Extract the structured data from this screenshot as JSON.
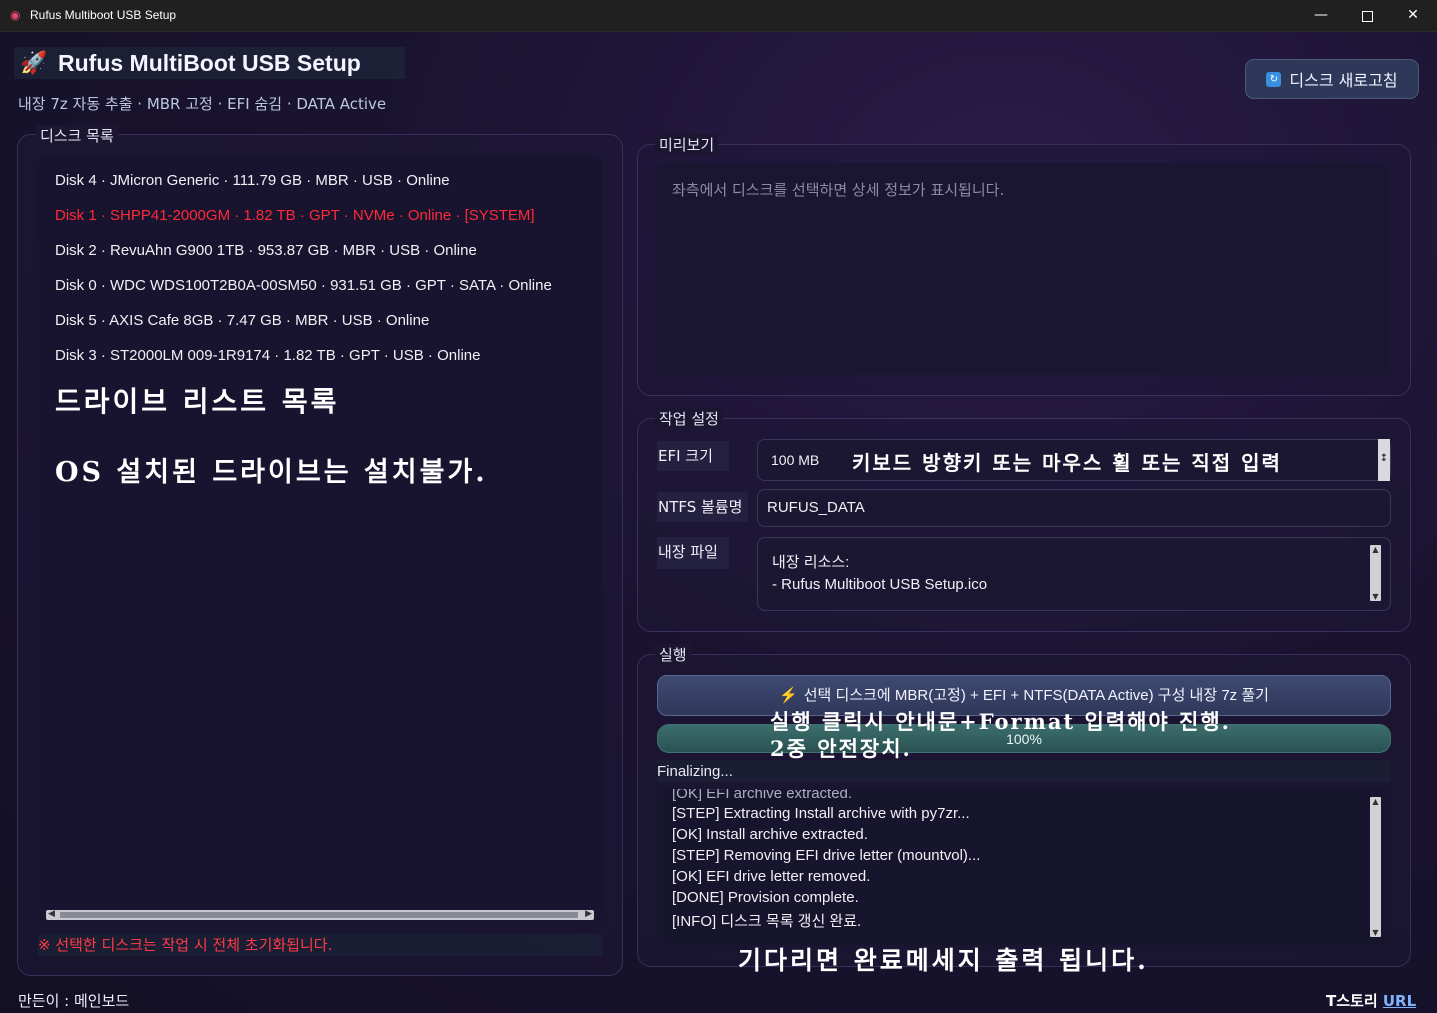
{
  "window": {
    "title": "Rufus Multiboot USB Setup"
  },
  "header": {
    "title": "Rufus MultiBoot USB Setup",
    "subtitle": "내장 7z 자동 추출 · MBR 고정 · EFI 숨김 · DATA Active",
    "refresh_label": "디스크 새로고침"
  },
  "disk_panel": {
    "label": "디스크 목록",
    "rows": [
      "Disk 4 · JMicron Generic · 111.79 GB · MBR · USB · Online",
      "Disk 1 · SHPP41-2000GM · 1.82 TB · GPT · NVMe · Online · [SYSTEM]",
      "Disk 2 · RevuAhn G900 1TB · 953.87 GB · MBR · USB · Online",
      "Disk 0 · WDC WDS100T2B0A-00SM50 · 931.51 GB · GPT · SATA · Online",
      "Disk 5 · AXIS Cafe 8GB · 7.47 GB · MBR · USB · Online",
      "Disk 3 · ST2000LM 009-1R9174 · 1.82 TB · GPT · USB · Online"
    ],
    "system_color": "#ff2a36",
    "annotation_1": "드라이브 리스트 목록",
    "annotation_2": "OS 설치된 드라이브는 설치불가.",
    "warning": "※ 선택한 디스크는 작업 시 전체 초기화됩니다."
  },
  "preview": {
    "label": "미리보기",
    "placeholder": "좌측에서 디스크를 선택하면 상세 정보가 표시됩니다."
  },
  "settings": {
    "label": "작업 설정",
    "efi_label": "EFI 크기",
    "efi_value": "100 MB",
    "efi_annotation": "키보드 방향키 또는 마우스 휠 또는 직접 입력",
    "ntfs_label": "NTFS 볼륨명",
    "ntfs_value": "RUFUS_DATA",
    "files_label": "내장 파일",
    "files_line1": "내장 리소스:",
    "files_line2": "- Rufus Multiboot USB Setup.ico"
  },
  "execute": {
    "label": "실행",
    "button_label": "선택 디스크에 MBR(고정) + EFI + NTFS(DATA Active) 구성  내장 7z 풀기",
    "annotation_1": "실행 클릭시 안내문+Format 입력해야 진행.",
    "annotation_2": "2중 안전장치.",
    "progress": 100,
    "progress_text": "100%",
    "status": "Finalizing...",
    "log": [
      "[STEP] Extracting Install archive with py7zr...",
      "[OK] Install archive extracted.",
      "[STEP] Removing EFI drive letter (mountvol)...",
      "[OK] EFI drive letter removed.",
      "[DONE] Provision complete.",
      "[INFO] 디스크 목록 갱신 완료."
    ],
    "annotation_3": "기다리면 완료메세지 출력 됩니다."
  },
  "footer": {
    "author": "만든이 : 메인보드",
    "blog_prefix": "T스토리",
    "blog_link": "URL"
  }
}
